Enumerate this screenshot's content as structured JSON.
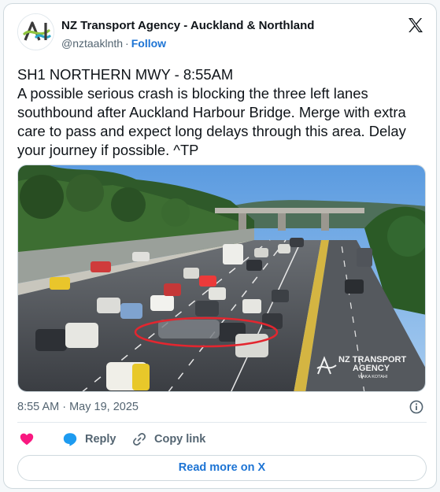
{
  "account": {
    "name": "NZ Transport Agency - Auckland & Northland",
    "handle": "@nztaaklnth",
    "separator": "·",
    "follow_label": "Follow"
  },
  "tweet": {
    "text": "SH1 NORTHERN MWY - 8:55AM\nA possible serious crash is blocking the three left lanes southbound after Auckland Harbour Bridge. Merge with extra care to pass and expect long delays through this area. Delay your journey if possible. ^TP",
    "timestamp": "8:55 AM · May 19, 2025"
  },
  "media": {
    "watermark_line1": "NZ TRANSPORT",
    "watermark_line2": "AGENCY",
    "watermark_line3": "WAKA KOTAHI",
    "highlight_color": "#e3262f"
  },
  "actions": {
    "like_icon": "heart-icon",
    "reply_label": "Reply",
    "copy_link_label": "Copy link"
  },
  "read_more_label": "Read more on X",
  "colors": {
    "link": "#1d74d4",
    "like": "#f91880",
    "reply": "#1d9bf0",
    "secondary_text": "#536471"
  }
}
